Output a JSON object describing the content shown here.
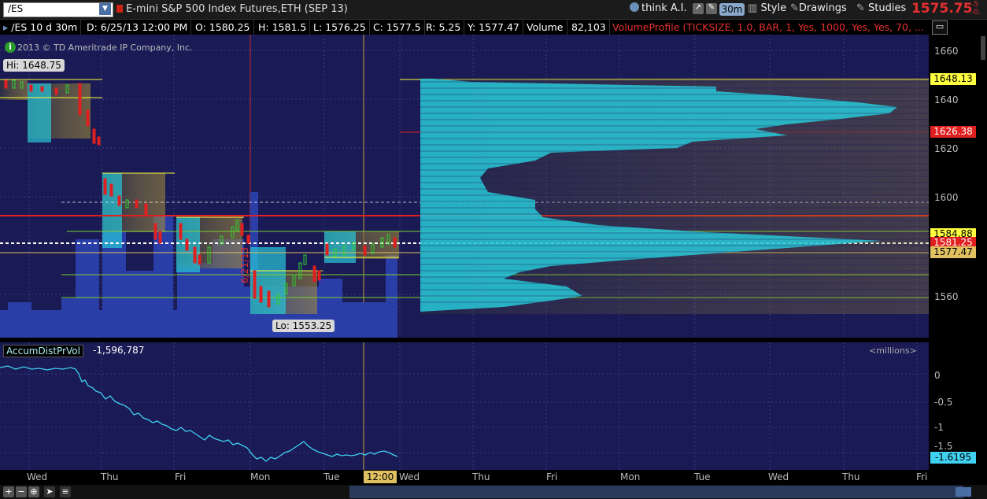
{
  "toolbar": {
    "symbol": "/ES",
    "description": "E-mini S&P 500 Index Futures,ETH (SEP 13)",
    "think_label": "think A.I.",
    "timeframe": "30m",
    "style_label": "Style",
    "drawings_label": "Drawings",
    "studies_label": "Studies",
    "last_price": "1575.75",
    "change": "-5\n-0.",
    "colors": {
      "last_price": "#e53030"
    }
  },
  "infobar": {
    "chart_id": "/ES 10 d 30m",
    "date": "D: 6/25/13 12:00 PM",
    "open": "O: 1580.25",
    "high": "H: 1581.5",
    "low": "L: 1576.25",
    "close": "C: 1577.5",
    "range": "R: 5.25",
    "y": "Y: 1577.47",
    "volume_label": "Volume",
    "volume_value": "82,103",
    "profile": "VolumeProfile (TICKSIZE, 1.0, BAR, 1, Yes, 1000, Yes, Yes, 70, ..."
  },
  "chart": {
    "copyright": "2013 © TD Ameritrade IP Company, Inc.",
    "hi_label": "Hi: 1648.75",
    "lo_label": "Lo: 1553.25",
    "date_marker": "6/21/13",
    "y_ticks": [
      "1660",
      "1640",
      "1620",
      "1600",
      "1560"
    ],
    "y_labels": [
      {
        "text": "1648.13",
        "bg": "#ffff40"
      },
      {
        "text": "1626.38",
        "bg": "#e02020"
      },
      {
        "text": "1584.88",
        "bg": "#ffff40"
      },
      {
        "text": "1581.25",
        "bg": "#e02020"
      },
      {
        "text": "1577.47",
        "bg": "#e0c060"
      }
    ]
  },
  "indicator": {
    "name": "AccumDistPrVol",
    "value": "-1,596,787",
    "unit": "<millions>",
    "y_ticks": [
      "0",
      "-0.5",
      "-1",
      "-1.5"
    ],
    "current_label": "-1.6195"
  },
  "xaxis": {
    "ticks": [
      "Wed",
      "Thu",
      "Fri",
      "Mon",
      "Tue",
      "Wed",
      "Thu",
      "Fri",
      "Mon",
      "Tue",
      "Wed",
      "Thu",
      "Fri"
    ],
    "time_label": "12:00"
  }
}
